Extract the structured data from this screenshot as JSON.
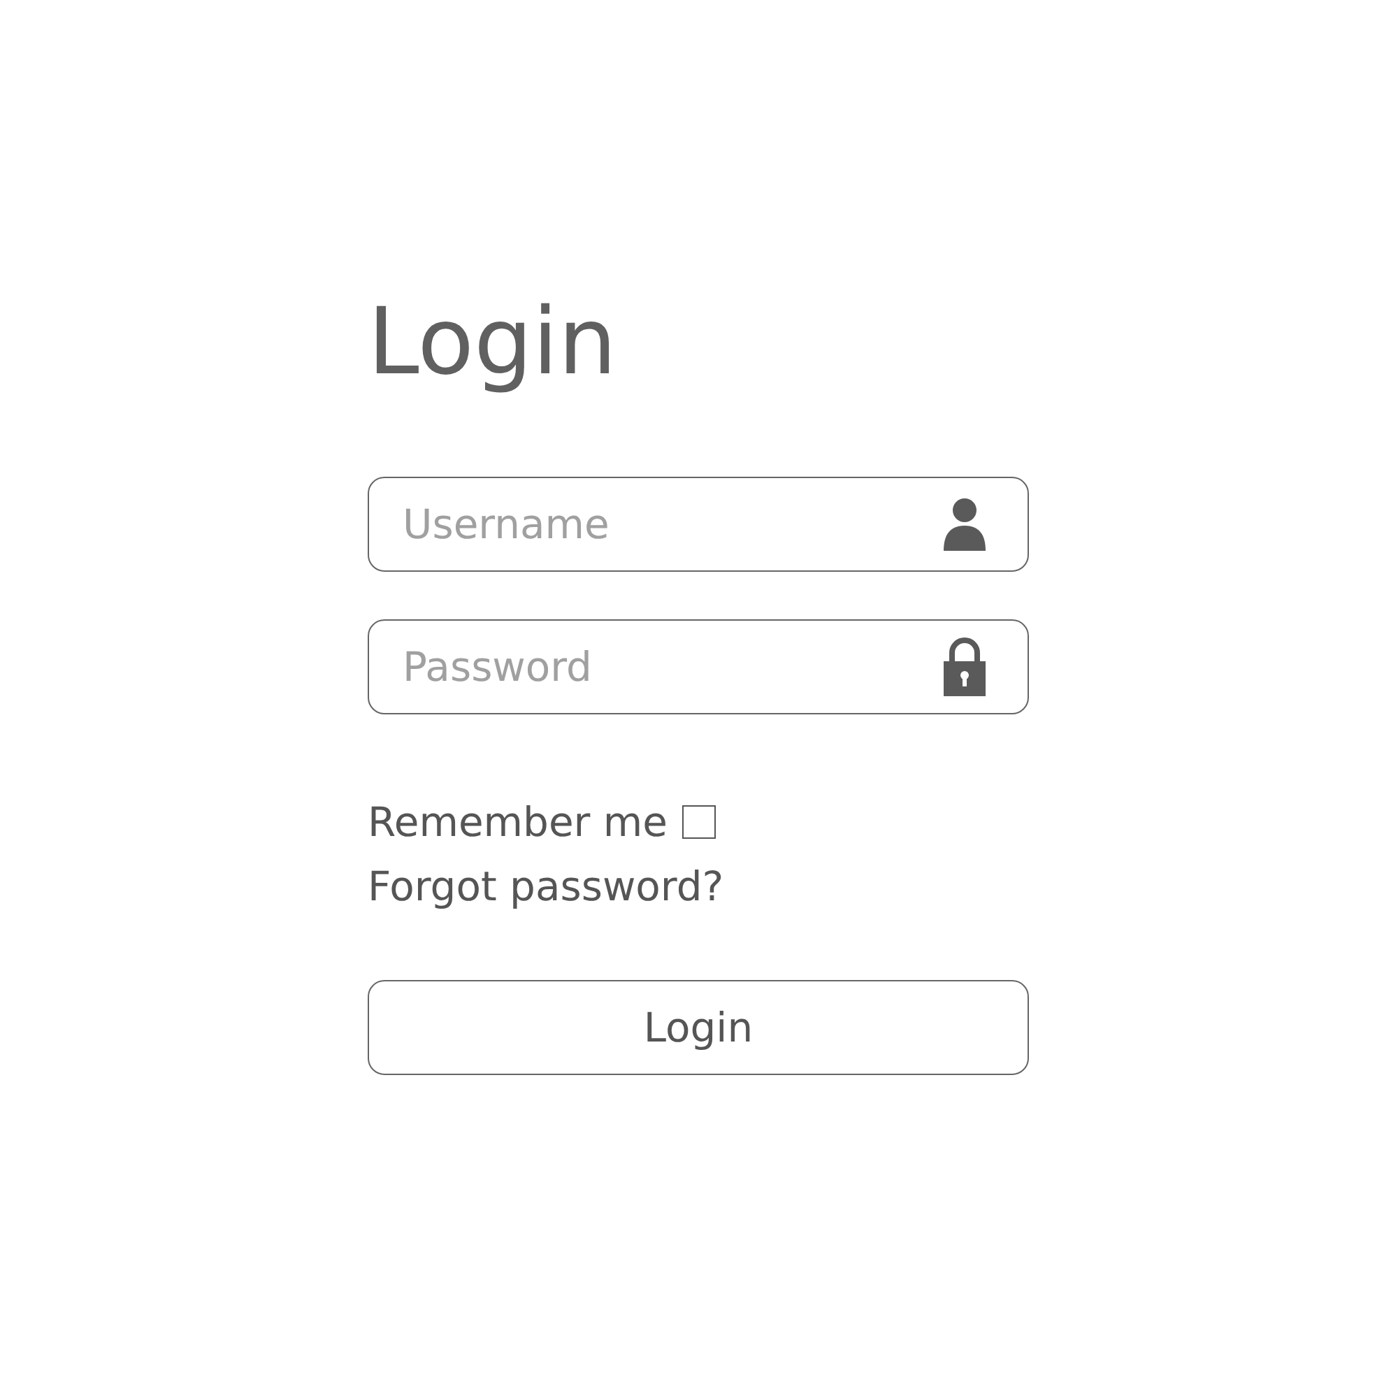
{
  "title": "Login",
  "fields": [
    {
      "kind": "user",
      "placeholder": "Username"
    },
    {
      "kind": "lock",
      "placeholder": "Password"
    }
  ],
  "remember": {
    "label": "Remember me",
    "checked": false
  },
  "forgot": {
    "label": "Forgot password?"
  },
  "button": {
    "label": "Login"
  }
}
